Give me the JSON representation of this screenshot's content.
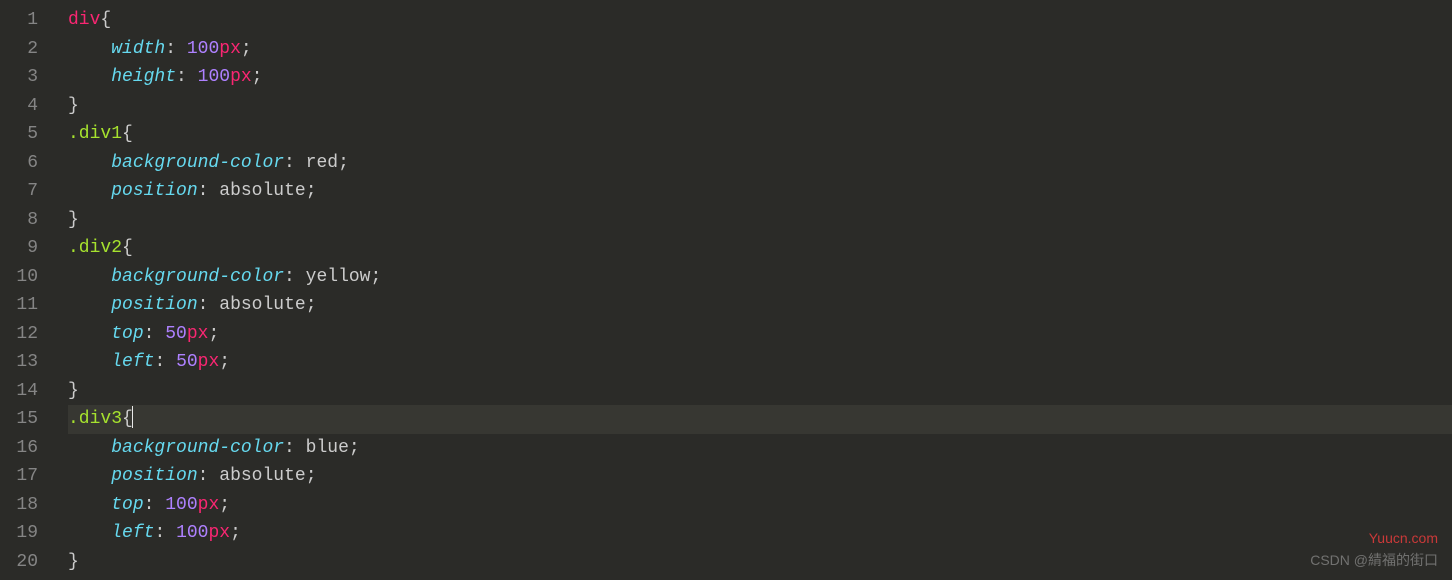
{
  "lines": {
    "1": {
      "num": "1"
    },
    "2": {
      "num": "2"
    },
    "3": {
      "num": "3"
    },
    "4": {
      "num": "4"
    },
    "5": {
      "num": "5"
    },
    "6": {
      "num": "6"
    },
    "7": {
      "num": "7"
    },
    "8": {
      "num": "8"
    },
    "9": {
      "num": "9"
    },
    "10": {
      "num": "10"
    },
    "11": {
      "num": "11"
    },
    "12": {
      "num": "12"
    },
    "13": {
      "num": "13"
    },
    "14": {
      "num": "14"
    },
    "15": {
      "num": "15"
    },
    "16": {
      "num": "16"
    },
    "17": {
      "num": "17"
    },
    "18": {
      "num": "18"
    },
    "19": {
      "num": "19"
    },
    "20": {
      "num": "20"
    }
  },
  "code": {
    "sel_div": "div",
    "sel_div1": ".div1",
    "sel_div2": ".div2",
    "sel_div3": ".div3",
    "brace_open": "{",
    "brace_close": "}",
    "prop_width": "width",
    "prop_height": "height",
    "prop_bgcolor": "background-color",
    "prop_position": "position",
    "prop_top": "top",
    "prop_left": "left",
    "colon": ":",
    "semicolon": ";",
    "space": " ",
    "num_100": "100",
    "num_50": "50",
    "unit_px": "px",
    "val_red": "red",
    "val_yellow": "yellow",
    "val_blue": "blue",
    "val_absolute": "absolute"
  },
  "watermark": {
    "top": "Yuucn.com",
    "bottom": "CSDN @綪福的街口"
  }
}
